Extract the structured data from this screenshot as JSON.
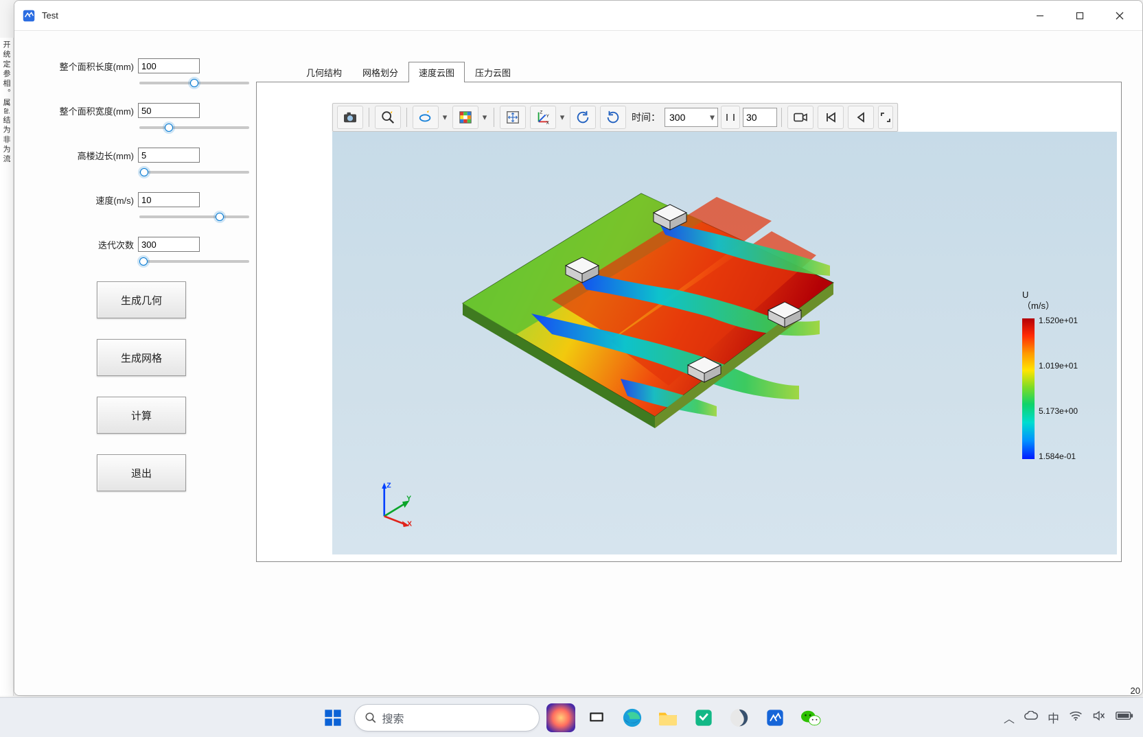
{
  "window": {
    "title": "Test"
  },
  "left_strip_lines": "开\n统\n定\n参\n相\n。\n属\nai\n结\n为\n非\n为\n流",
  "params": {
    "area_len": {
      "label": "整个面积长度(mm)",
      "value": "100"
    },
    "area_wid": {
      "label": "整个面积宽度(mm)",
      "value": "50"
    },
    "tower_side": {
      "label": "高楼边长(mm)",
      "value": "5"
    },
    "velocity": {
      "label": "速度(m/s)",
      "value": "10"
    },
    "iters": {
      "label": "迭代次数",
      "value": "300"
    }
  },
  "buttons": {
    "gen_geom": "生成几何",
    "gen_mesh": "生成网格",
    "compute": "计算",
    "exit": "退出"
  },
  "tabs": {
    "geom": "几何结构",
    "mesh": "网格划分",
    "vel": "速度云图",
    "press": "压力云图"
  },
  "toolbar": {
    "time_label": "时间：",
    "time_value": "300",
    "step_value": "30"
  },
  "legend": {
    "title1": "U",
    "title2": "（m/s）",
    "t0": "1.520e+01",
    "t1": "1.019e+01",
    "t2": "5.173e+00",
    "t3": "1.584e-01"
  },
  "triad": {
    "x": "X",
    "y": "Y",
    "z": "Z"
  },
  "taskbar": {
    "search_placeholder": "搜索",
    "ime": "中"
  },
  "corner": "20",
  "chart_data": {
    "type": "heatmap",
    "title": "速度云图 U (m/s)",
    "colorbar": {
      "label": "U (m/s)",
      "min": 0.1584,
      "max": 15.2,
      "ticks": [
        15.2,
        10.19,
        5.173,
        0.1584
      ]
    },
    "domain": {
      "length_mm": 100,
      "width_mm": 50,
      "tower_side_mm": 5,
      "inlet_velocity_m_s": 10,
      "iterations": 300
    },
    "description": "CFD velocity magnitude contour on a flat rectangular plate with four cubic obstacles; high-speed (red ~15 m/s) regions between obstacle wakes, low-speed (blue ~0.16 m/s) wakes downstream of each cube."
  }
}
